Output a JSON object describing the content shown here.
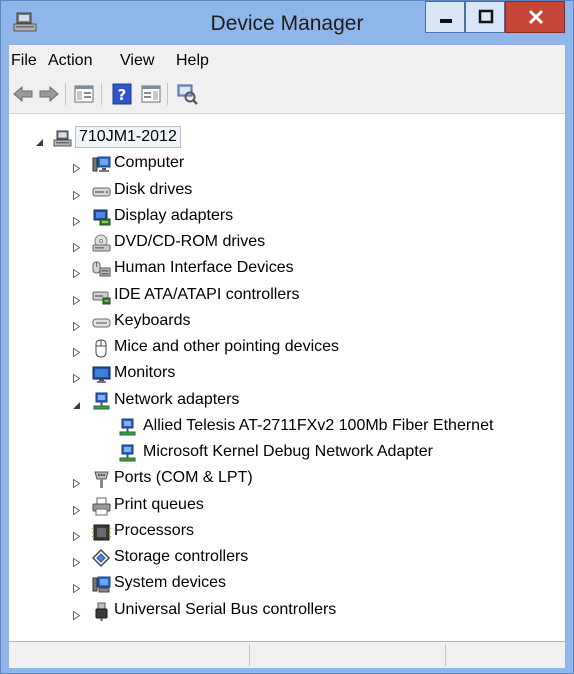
{
  "window": {
    "title": "Device Manager",
    "accent_color": "#8fb6e8",
    "close_color": "#c7463a",
    "app_icon": "device-manager-icon"
  },
  "menu": [
    {
      "label": "File"
    },
    {
      "label": "Action"
    },
    {
      "label": "View"
    },
    {
      "label": "Help"
    }
  ],
  "toolbar": {
    "buttons": [
      {
        "icon": "back-arrow-icon"
      },
      {
        "icon": "forward-arrow-icon"
      },
      {
        "icon": "show-hide-console-tree-icon"
      },
      {
        "icon": "help-icon"
      },
      {
        "icon": "properties-pane-icon"
      },
      {
        "icon": "scan-hardware-icon"
      }
    ]
  },
  "tree": {
    "root": {
      "label": "710JM1-2012",
      "icon": "computer-root-icon",
      "expanded": true
    },
    "items": [
      {
        "label": "Computer",
        "icon": "computer-icon",
        "expanded": false
      },
      {
        "label": "Disk drives",
        "icon": "disk-drive-icon",
        "expanded": false
      },
      {
        "label": "Display adapters",
        "icon": "display-adapter-icon",
        "expanded": false
      },
      {
        "label": "DVD/CD-ROM drives",
        "icon": "dvd-drive-icon",
        "expanded": false
      },
      {
        "label": "Human Interface Devices",
        "icon": "hid-icon",
        "expanded": false
      },
      {
        "label": "IDE ATA/ATAPI controllers",
        "icon": "ide-controller-icon",
        "expanded": false
      },
      {
        "label": "Keyboards",
        "icon": "keyboard-icon",
        "expanded": false
      },
      {
        "label": "Mice and other pointing devices",
        "icon": "mouse-icon",
        "expanded": false
      },
      {
        "label": "Monitors",
        "icon": "monitor-icon",
        "expanded": false
      },
      {
        "label": "Network adapters",
        "icon": "network-adapter-icon",
        "expanded": true,
        "children": [
          {
            "label": "Allied Telesis AT-2711FXv2 100Mb Fiber Ethernet",
            "icon": "network-adapter-icon"
          },
          {
            "label": "Microsoft Kernel Debug Network Adapter",
            "icon": "network-adapter-icon"
          }
        ]
      },
      {
        "label": "Ports (COM & LPT)",
        "icon": "port-icon",
        "expanded": false
      },
      {
        "label": "Print queues",
        "icon": "printer-icon",
        "expanded": false
      },
      {
        "label": "Processors",
        "icon": "processor-icon",
        "expanded": false
      },
      {
        "label": "Storage controllers",
        "icon": "storage-controller-icon",
        "expanded": false
      },
      {
        "label": "System devices",
        "icon": "system-devices-icon",
        "expanded": false
      },
      {
        "label": "Universal Serial Bus controllers",
        "icon": "usb-icon",
        "expanded": false
      }
    ]
  },
  "statusbar": {
    "panels": [
      "",
      "",
      ""
    ]
  }
}
